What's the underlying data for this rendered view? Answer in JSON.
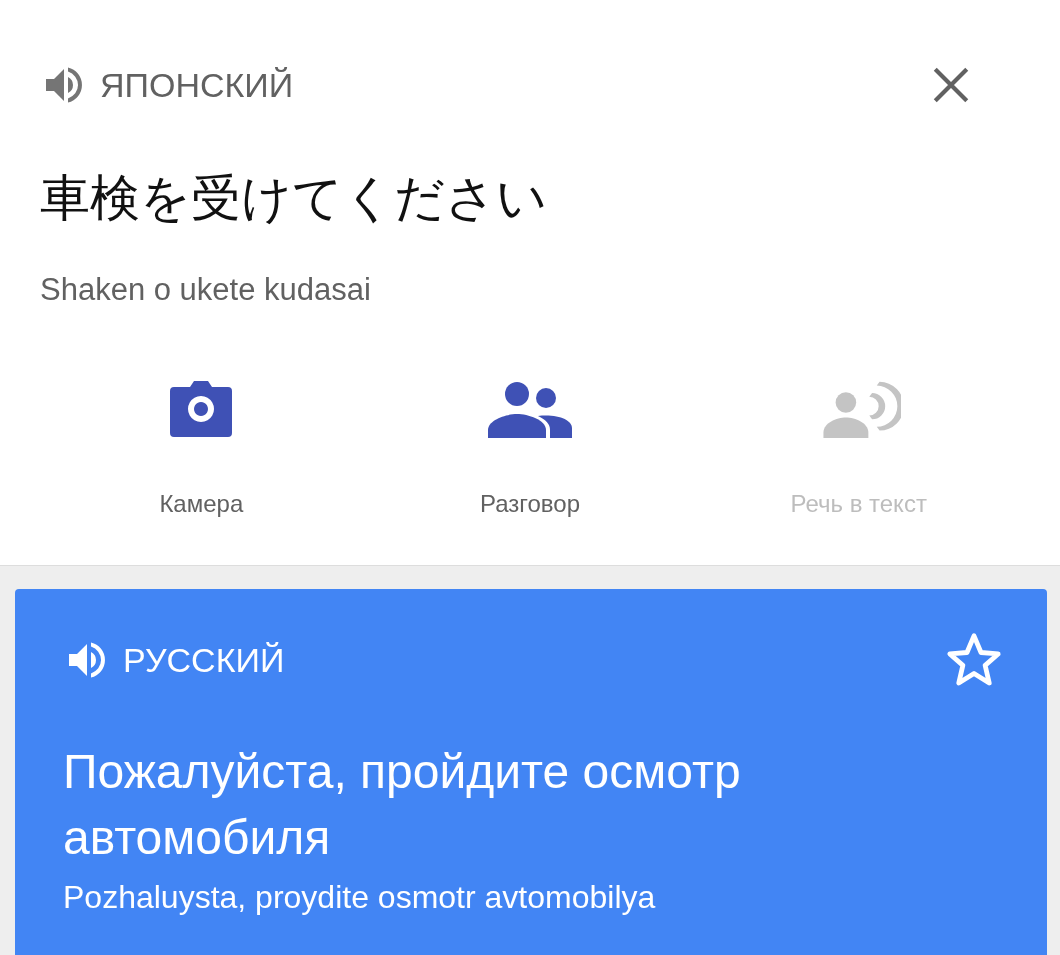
{
  "source": {
    "language": "ЯПОНСКИЙ",
    "text": "車検を受けてください",
    "transliteration": "Shaken o ukete kudasai"
  },
  "actions": [
    {
      "kind": "camera",
      "label": "Камера",
      "disabled": false
    },
    {
      "kind": "conversation",
      "label": "Разговор",
      "disabled": false
    },
    {
      "kind": "speech",
      "label": "Речь в текст",
      "disabled": true
    }
  ],
  "translation": {
    "language": "РУССКИЙ",
    "starred": false,
    "text": "Пожалуйста, пройдите осмотр автомобиля",
    "transliteration": "Pozhaluysta, proydite osmotr avtomobilya"
  }
}
